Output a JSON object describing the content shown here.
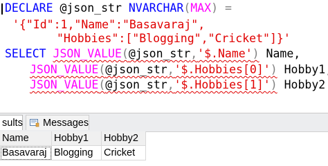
{
  "editor": {
    "line1": {
      "declare": "DECLARE",
      "variable": "@json_str",
      "type": "NVARCHAR",
      "paren_open": "(",
      "max": "MAX",
      "paren_close": ")",
      "equals": "="
    },
    "line2": {
      "string": "'{\"Id\":1,\"Name\":\"Basavaraj\","
    },
    "line3": {
      "string": "\"Hobbies\":[\"Blogging\",\"Cricket\"]}'"
    },
    "line4": {
      "select": "SELECT",
      "fn": "JSON_VALUE",
      "paren_open": "(",
      "variable": "@json_str",
      "comma": ",",
      "path": "'$.Name'",
      "paren_close": ")",
      "alias": "Name,"
    },
    "line5": {
      "fn": "JSON_VALUE",
      "paren_open": "(",
      "variable": "@json_str",
      "comma": ",",
      "path": "'$.Hobbies[0]'",
      "paren_close": ")",
      "alias": "Hobby1,"
    },
    "line6": {
      "fn": "JSON_VALUE",
      "paren_open": "(",
      "variable": "@json_str",
      "comma": ",",
      "path": "'$.Hobbies[1]'",
      "paren_close": ")",
      "alias": "Hobby2"
    }
  },
  "results_tabs": {
    "results_label": "sults",
    "messages_label": "Messages",
    "messages_icon": "messages-icon"
  },
  "grid": {
    "columns": [
      "Name",
      "Hobby1",
      "Hobby2"
    ],
    "rows": [
      [
        "Basavaraj",
        "Blogging",
        "Cricket"
      ]
    ]
  },
  "colors": {
    "keyword": "#0000ff",
    "function": "#ff00ff",
    "string": "#e00000",
    "operator": "#808080"
  }
}
